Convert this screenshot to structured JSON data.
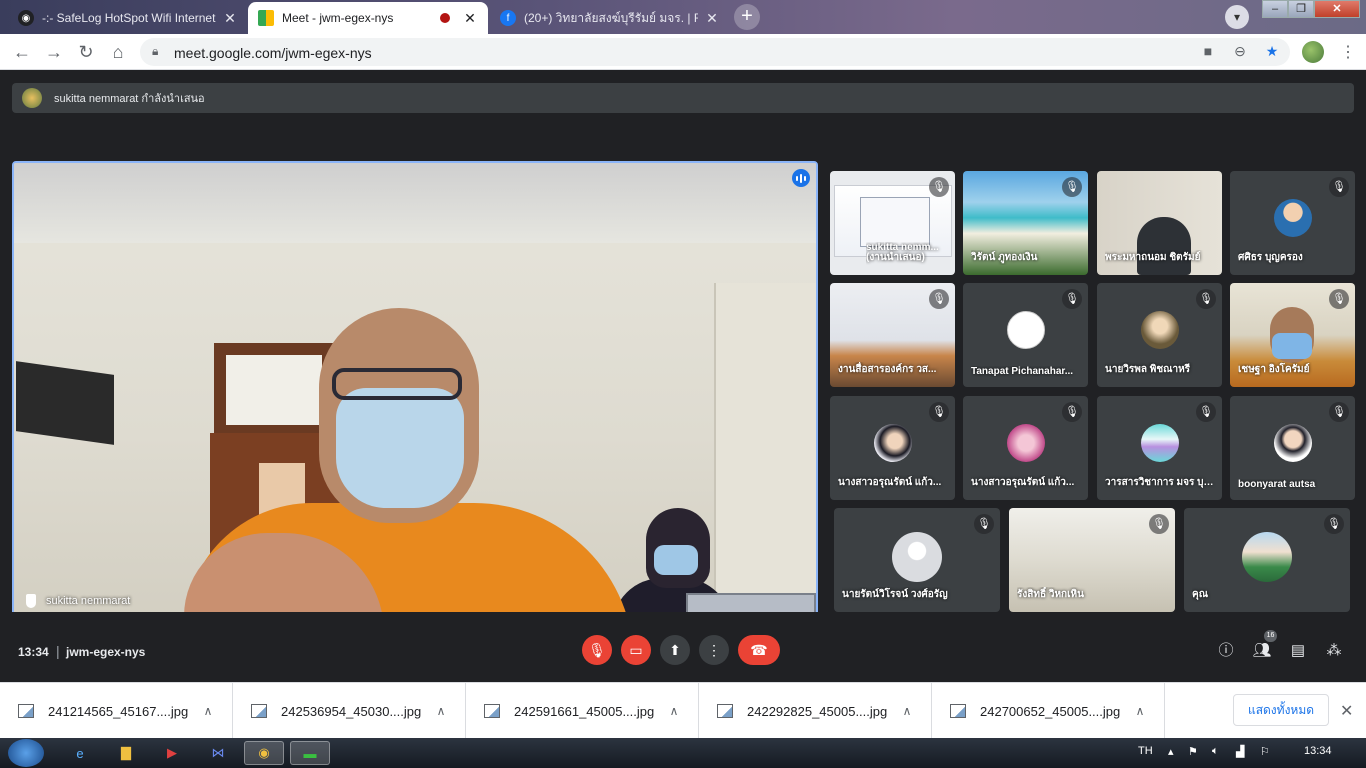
{
  "browser": {
    "tabs": [
      {
        "title": "-:- SafeLog HotSpot Wifi Internet",
        "active": false
      },
      {
        "title": "Meet - jwm-egex-nys",
        "active": true
      },
      {
        "title": "(20+) วิทยาลัยสงฆ์บุรีรัมย์ มจร. | Fa",
        "active": false
      }
    ],
    "new_tab": "+",
    "url": "meet.google.com/jwm-egex-nys"
  },
  "meet": {
    "presenting_text": "sukitta nemmarat กำลังนำเสนอ",
    "main_speaker": "sukitta nemmarat",
    "tiles": [
      {
        "name": "sukitta nemm... (งานนำเสนอ)",
        "line1": "sukitta nemm...",
        "line2": "(งานนำเสนอ)"
      },
      {
        "name": "วิรัตน์ ภูทองเงิน"
      },
      {
        "name": "พระมหาถนอม ชิตรัมย์"
      },
      {
        "name": "ศศิธร บุญครอง"
      },
      {
        "name": "งานสื่อสารองค์กร วส..."
      },
      {
        "name": "Tanapat Pichanahar..."
      },
      {
        "name": "นายวิรพล พิชณาหรี"
      },
      {
        "name": "เชษฐา อิงโครัมย์"
      },
      {
        "name": "นางสาวอรุณรัตน์ แก้ว..."
      },
      {
        "name": "นางสาวอรุณรัตน์ แก้ว... "
      },
      {
        "name": "วารสารวิชาการ มจร บุรี..."
      },
      {
        "name": "boonyarat autsa"
      },
      {
        "name": "นายรัตน์วิโรจน์ วงศ์อรัญ"
      },
      {
        "name": "รังสิทธิ์ วิหกเหิน"
      },
      {
        "name": "คุณ"
      }
    ],
    "clock": "13:34",
    "separator": "|",
    "meeting_code": "jwm-egex-nys",
    "participants_count": "16"
  },
  "downloads": {
    "items": [
      "241214565_45167....jpg",
      "242536954_45030....jpg",
      "242591661_45005....jpg",
      "242292825_45005....jpg",
      "242700652_45005....jpg"
    ],
    "show_all": "แสดงทั้งหมด"
  },
  "taskbar": {
    "lang": "TH",
    "time": "13:34"
  }
}
